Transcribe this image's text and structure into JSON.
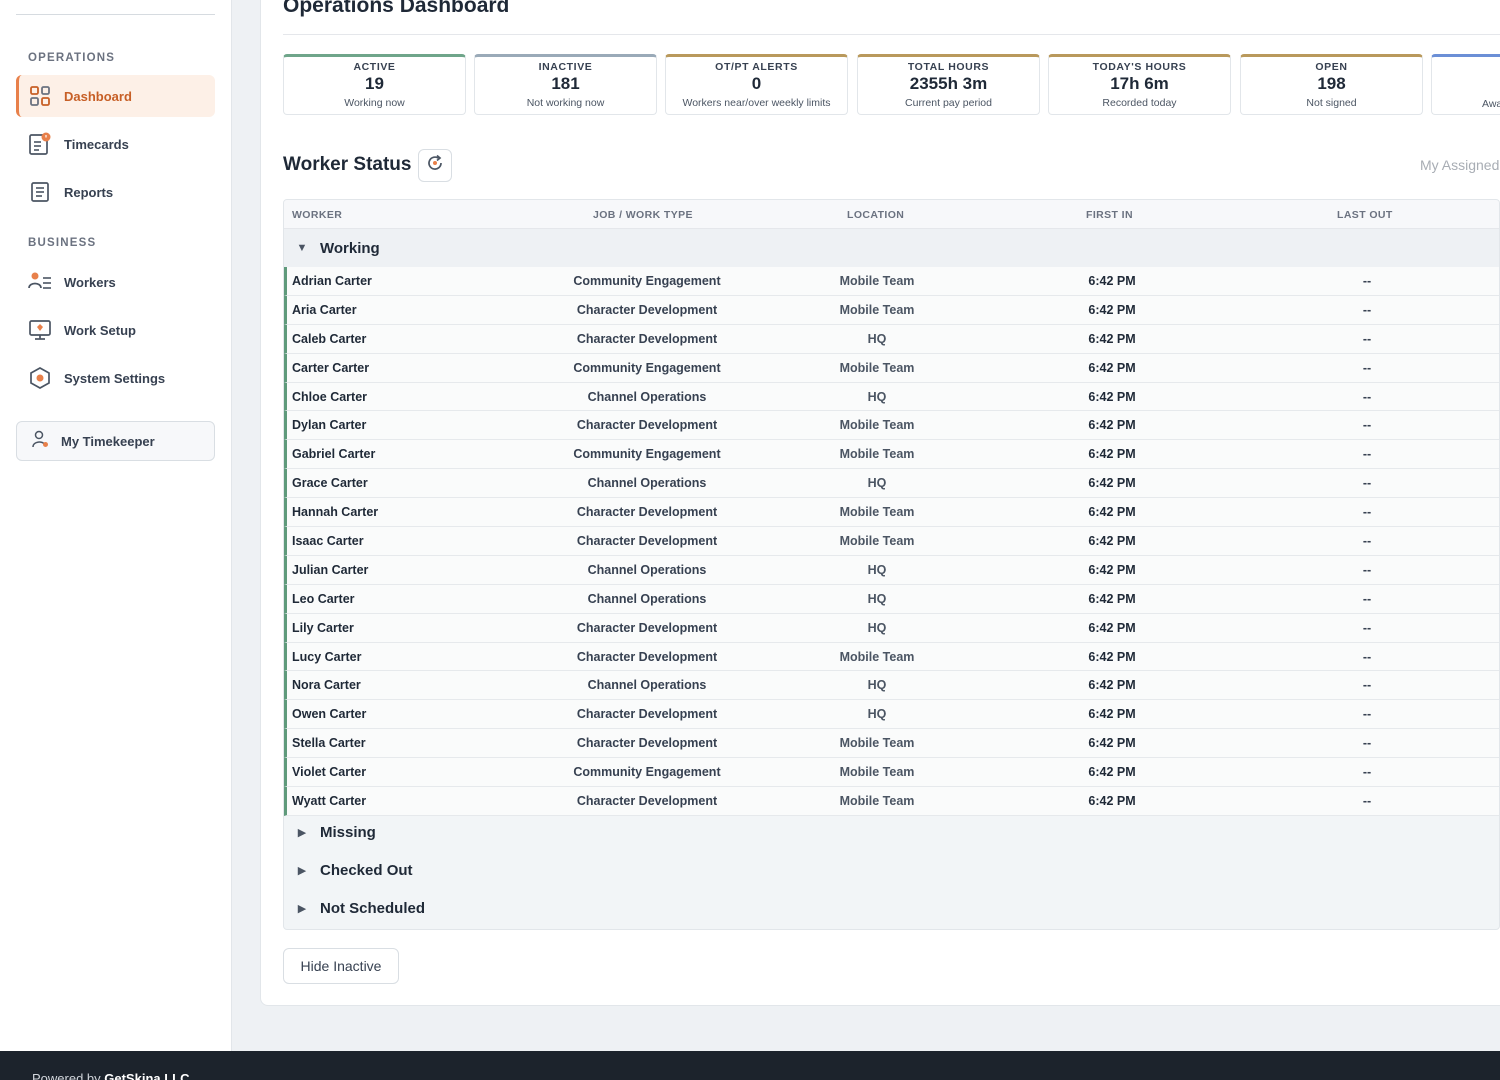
{
  "sidebar": {
    "sections": [
      {
        "label": "OPERATIONS"
      },
      {
        "label": "BUSINESS"
      }
    ],
    "items": [
      {
        "label": "Dashboard",
        "icon": "grid-icon",
        "active": true
      },
      {
        "label": "Timecards",
        "icon": "timecard-icon"
      },
      {
        "label": "Reports",
        "icon": "report-icon"
      },
      {
        "label": "Workers",
        "icon": "workers-icon"
      },
      {
        "label": "Work Setup",
        "icon": "monitor-icon"
      },
      {
        "label": "System Settings",
        "icon": "settings-hex-icon"
      }
    ],
    "timekeeper_label": "My Timekeeper"
  },
  "header": {
    "title": "Operations Dashboard"
  },
  "stats": [
    {
      "label": "ACTIVE",
      "value": "19",
      "sub": "Working now",
      "color": "#6fa58a"
    },
    {
      "label": "INACTIVE",
      "value": "181",
      "sub": "Not working now",
      "color": "#9aaab8"
    },
    {
      "label": "OT/PT ALERTS",
      "value": "0",
      "sub": "Workers near/over weekly limits",
      "color": "#b9995c"
    },
    {
      "label": "TOTAL HOURS",
      "value": "2355h 3m",
      "sub": "Current pay period",
      "color": "#b9995c"
    },
    {
      "label": "TODAY'S HOURS",
      "value": "17h 6m",
      "sub": "Recorded today",
      "color": "#b9995c"
    },
    {
      "label": "OPEN",
      "value": "198",
      "sub": "Not signed",
      "color": "#b9995c"
    },
    {
      "label": "",
      "value": "",
      "sub": "Awa",
      "color": "#6b8fd6"
    }
  ],
  "worker_status": {
    "title": "Worker Status",
    "assigned_label": "My Assigned",
    "columns": [
      "WORKER",
      "JOB / WORK TYPE",
      "LOCATION",
      "FIRST IN",
      "LAST OUT"
    ],
    "groups": [
      "Working",
      "Missing",
      "Checked Out",
      "Not Scheduled"
    ],
    "rows": [
      {
        "name": "Adrian Carter",
        "job": "Community Engagement",
        "location": "Mobile Team",
        "first_in": "6:42 PM",
        "last_out": "--"
      },
      {
        "name": "Aria Carter",
        "job": "Character Development",
        "location": "Mobile Team",
        "first_in": "6:42 PM",
        "last_out": "--"
      },
      {
        "name": "Caleb Carter",
        "job": "Character Development",
        "location": "HQ",
        "first_in": "6:42 PM",
        "last_out": "--"
      },
      {
        "name": "Carter Carter",
        "job": "Community Engagement",
        "location": "Mobile Team",
        "first_in": "6:42 PM",
        "last_out": "--"
      },
      {
        "name": "Chloe Carter",
        "job": "Channel Operations",
        "location": "HQ",
        "first_in": "6:42 PM",
        "last_out": "--"
      },
      {
        "name": "Dylan Carter",
        "job": "Character Development",
        "location": "Mobile Team",
        "first_in": "6:42 PM",
        "last_out": "--"
      },
      {
        "name": "Gabriel Carter",
        "job": "Community Engagement",
        "location": "Mobile Team",
        "first_in": "6:42 PM",
        "last_out": "--"
      },
      {
        "name": "Grace Carter",
        "job": "Channel Operations",
        "location": "HQ",
        "first_in": "6:42 PM",
        "last_out": "--"
      },
      {
        "name": "Hannah Carter",
        "job": "Character Development",
        "location": "Mobile Team",
        "first_in": "6:42 PM",
        "last_out": "--"
      },
      {
        "name": "Isaac Carter",
        "job": "Character Development",
        "location": "Mobile Team",
        "first_in": "6:42 PM",
        "last_out": "--"
      },
      {
        "name": "Julian Carter",
        "job": "Channel Operations",
        "location": "HQ",
        "first_in": "6:42 PM",
        "last_out": "--"
      },
      {
        "name": "Leo Carter",
        "job": "Channel Operations",
        "location": "HQ",
        "first_in": "6:42 PM",
        "last_out": "--"
      },
      {
        "name": "Lily Carter",
        "job": "Character Development",
        "location": "HQ",
        "first_in": "6:42 PM",
        "last_out": "--"
      },
      {
        "name": "Lucy Carter",
        "job": "Character Development",
        "location": "Mobile Team",
        "first_in": "6:42 PM",
        "last_out": "--"
      },
      {
        "name": "Nora Carter",
        "job": "Channel Operations",
        "location": "HQ",
        "first_in": "6:42 PM",
        "last_out": "--"
      },
      {
        "name": "Owen Carter",
        "job": "Character Development",
        "location": "HQ",
        "first_in": "6:42 PM",
        "last_out": "--"
      },
      {
        "name": "Stella Carter",
        "job": "Character Development",
        "location": "Mobile Team",
        "first_in": "6:42 PM",
        "last_out": "--"
      },
      {
        "name": "Violet Carter",
        "job": "Community Engagement",
        "location": "Mobile Team",
        "first_in": "6:42 PM",
        "last_out": "--"
      },
      {
        "name": "Wyatt Carter",
        "job": "Character Development",
        "location": "Mobile Team",
        "first_in": "6:42 PM",
        "last_out": "--"
      }
    ]
  },
  "hide_inactive_label": "Hide Inactive",
  "footer": {
    "prefix": "Powered by ",
    "company": "GetSkina LLC"
  },
  "colors": {
    "accent": "#e8804a",
    "working": "#5f9a7b"
  }
}
